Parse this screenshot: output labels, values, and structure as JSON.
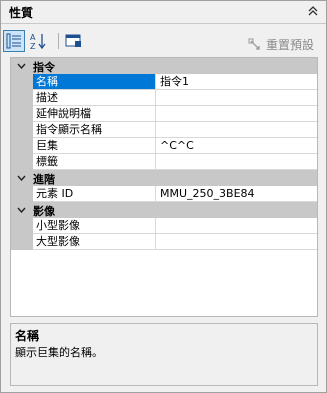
{
  "panel": {
    "title": "性質"
  },
  "toolbar": {
    "reset_label": "重置預設",
    "buttons": [
      "categorized-view",
      "alphabetical-view",
      "property-pages"
    ]
  },
  "categories": [
    {
      "name": "指令",
      "rows": [
        {
          "name": "名稱",
          "value": "指令1"
        },
        {
          "name": "描述",
          "value": ""
        },
        {
          "name": "延伸說明檔",
          "value": ""
        },
        {
          "name": "指令顯示名稱",
          "value": ""
        },
        {
          "name": "巨集",
          "value": "^C^C"
        },
        {
          "name": "標籤",
          "value": ""
        }
      ]
    },
    {
      "name": "進階",
      "rows": [
        {
          "name": "元素 ID",
          "value": "MMU_250_3BE84"
        }
      ]
    },
    {
      "name": "影像",
      "rows": [
        {
          "name": "小型影像",
          "value": ""
        },
        {
          "name": "大型影像",
          "value": ""
        }
      ]
    }
  ],
  "help": {
    "title": "名稱",
    "description": "顯示巨集的名稱。"
  },
  "colors": {
    "selection": "#0078d7",
    "category_bg": "#c8c8c8"
  }
}
